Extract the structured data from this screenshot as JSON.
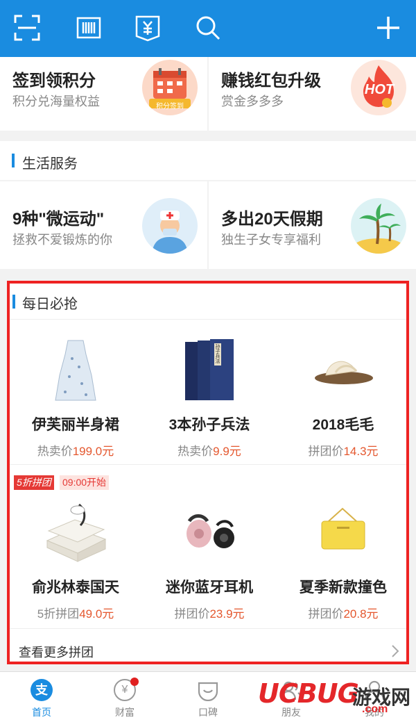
{
  "topbar": {
    "icons": [
      "scan-icon",
      "barcode-icon",
      "payment-code-icon",
      "search-icon",
      "add-icon"
    ]
  },
  "promo_top": [
    {
      "title": "签到领积分",
      "subtitle": "积分兑海量权益",
      "badge": "积分签到"
    },
    {
      "title": "赚钱红包升级",
      "subtitle": "赏金多多多",
      "badge": "HOT"
    }
  ],
  "life_services": {
    "title": "生活服务",
    "cards": [
      {
        "title": "9种\"微运动\"",
        "subtitle": "拯救不爱锻炼的你"
      },
      {
        "title": "多出20天假期",
        "subtitle": "独生子女专享福利"
      }
    ]
  },
  "daily": {
    "title": "每日必抢",
    "row1": [
      {
        "name": "伊芙丽半身裙",
        "price_label": "热卖价",
        "price": "199.0元"
      },
      {
        "name": "3本孙子兵法",
        "price_label": "热卖价",
        "price": "9.9元",
        "book_text": "孙子兵法"
      },
      {
        "name": "2018毛毛",
        "price_label": "拼团价",
        "price": "14.3元"
      }
    ],
    "group_badge": "5折拼团",
    "group_time": "09:00开始",
    "row2": [
      {
        "name": "俞兆林泰国天",
        "price_label": "5折拼团",
        "price": "49.0元"
      },
      {
        "name": "迷你蓝牙耳机",
        "price_label": "拼团价",
        "price": "23.9元"
      },
      {
        "name": "夏季新款撞色",
        "price_label": "拼团价",
        "price": "20.8元"
      }
    ],
    "more_label": "查看更多拼团"
  },
  "bottom_nav": [
    {
      "label": "首页",
      "active": true,
      "icon_text": "支"
    },
    {
      "label": "财富",
      "active": false,
      "icon_text": "¥"
    },
    {
      "label": "口碑",
      "active": false
    },
    {
      "label": "朋友",
      "active": false
    },
    {
      "label": "我的",
      "active": false
    }
  ],
  "watermark": {
    "brand": "UCBUG",
    "text": "游戏网",
    "domain": ".com"
  },
  "colors": {
    "accent": "#1a8ce0",
    "price": "#e4572e",
    "highlight_border": "#ee2222"
  }
}
